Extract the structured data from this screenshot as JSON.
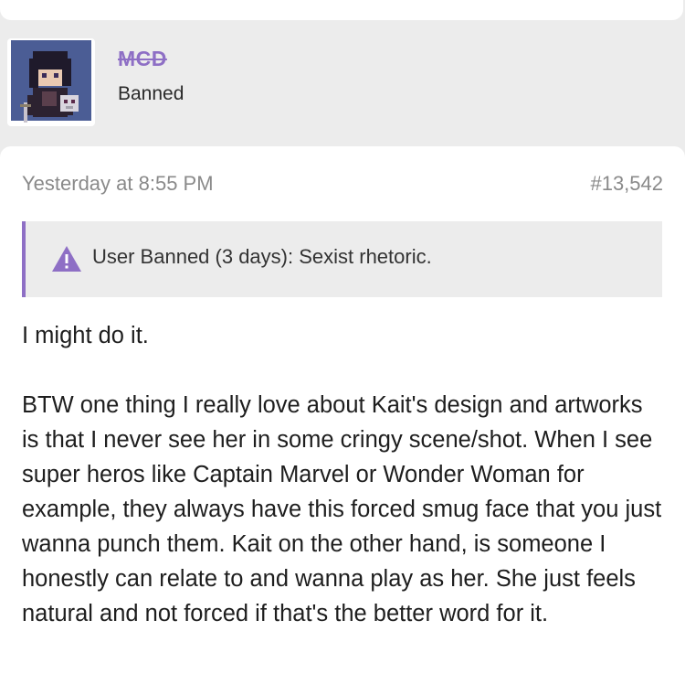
{
  "user": {
    "username": "MCD",
    "title": "Banned",
    "avatar_icon": "pixel-character-avatar"
  },
  "post": {
    "date": "Yesterday at 8:55 PM",
    "number": "#13,542",
    "notice": {
      "icon": "warning-triangle-icon",
      "text": "User Banned (3 days): Sexist rhetoric."
    },
    "paragraphs": [
      "I might do it.",
      "BTW one thing I really love about Kait's design and artworks is that I never see her in some cringy scene/shot. When I see super heros like Captain Marvel or Wonder Woman for example, they always have this forced smug face that you just wanna punch them. Kait on the other hand, is someone I honestly can relate to and wanna play as her. She just feels natural and not forced if that's the better word for it."
    ]
  },
  "colors": {
    "accent": "#8e6fc5",
    "page_background": "#ececec",
    "card_background": "#ffffff",
    "notice_background": "#ececec",
    "meta_text": "#8a8a8a",
    "body_text": "#1e1e1e"
  }
}
